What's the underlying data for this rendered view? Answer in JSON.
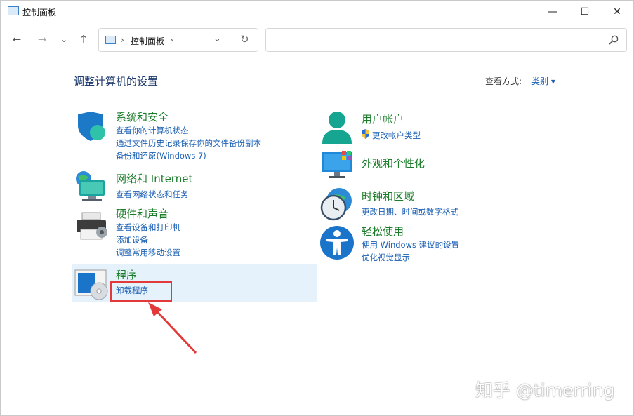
{
  "window": {
    "title": "控制面板",
    "controls": {
      "minimize": "—",
      "maximize": "☐",
      "close": "✕"
    }
  },
  "nav": {
    "back": "←",
    "forward": "→",
    "recent": "⌄",
    "up": "↑",
    "breadcrumb_sep": "›",
    "breadcrumb": "控制面板",
    "address_drop": "⌄",
    "refresh": "↻",
    "search_placeholder": ""
  },
  "page": {
    "heading": "调整计算机的设置",
    "view_by_label": "查看方式:",
    "view_by_value": "类别 ▾"
  },
  "categories_left": [
    {
      "title": "系统和安全",
      "icon": "shield-icon",
      "links": [
        "查看你的计算机状态",
        "通过文件历史记录保存你的文件备份副本",
        "备份和还原(Windows 7)"
      ]
    },
    {
      "title": "网络和 Internet",
      "icon": "network-icon",
      "links": [
        "查看网络状态和任务"
      ]
    },
    {
      "title": "硬件和声音",
      "icon": "printer-icon",
      "links": [
        "查看设备和打印机",
        "添加设备",
        "调整常用移动设置"
      ]
    },
    {
      "title": "程序",
      "icon": "programs-icon",
      "links": [
        "卸载程序"
      ]
    }
  ],
  "categories_right": [
    {
      "title": "用户帐户",
      "icon": "user-icon",
      "links": [
        "更改帐户类型"
      ]
    },
    {
      "title": "外观和个性化",
      "icon": "monitor-icon",
      "links": []
    },
    {
      "title": "时钟和区域",
      "icon": "clock-globe-icon",
      "links": [
        "更改日期、时间或数字格式"
      ]
    },
    {
      "title": "轻松使用",
      "icon": "accessibility-icon",
      "links": [
        "使用 Windows 建议的设置",
        "优化视觉显示"
      ]
    }
  ],
  "watermark": "知乎 @timerring",
  "colors": {
    "category_title": "#1b7d2a",
    "link": "#1a5fb4",
    "heading": "#1e3a6e",
    "highlight": "#e5f1fb",
    "annotation": "#e23a3a"
  }
}
